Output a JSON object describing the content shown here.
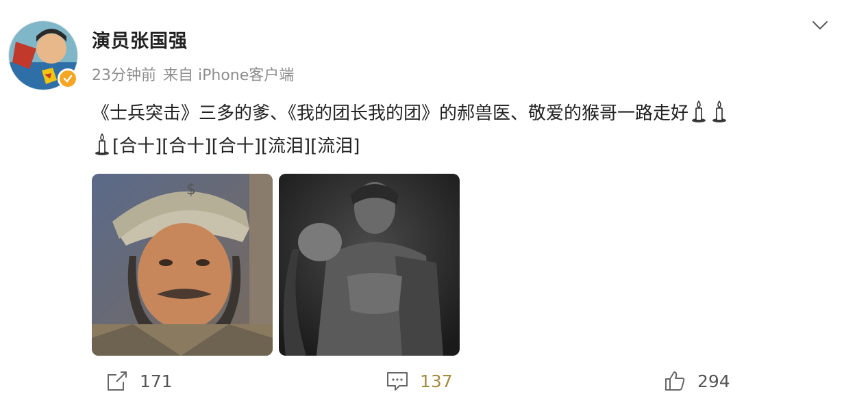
{
  "post": {
    "username": "演员张国强",
    "time": "23分钟前",
    "source": "来自 iPhone客户端",
    "text_line1": "《士兵突击》三多的爹、《我的团长我的团》的郝兽医、敬爱的猴哥一路走好",
    "text_line2": "[合十][合十][合十][流泪][流泪]",
    "candle_emoji": "candle-icon"
  },
  "photos": [
    {
      "name": "photo-1",
      "desc_icon": "portrait-photo"
    },
    {
      "name": "photo-2",
      "desc_icon": "bw-still-photo"
    }
  ],
  "actions": {
    "repost_count": "171",
    "comment_count": "137",
    "like_count": "294"
  },
  "colors": {
    "accent_verified": "#f5a623",
    "meta_gray": "#8e8e8e",
    "comment_gold": "#a58a3c"
  }
}
